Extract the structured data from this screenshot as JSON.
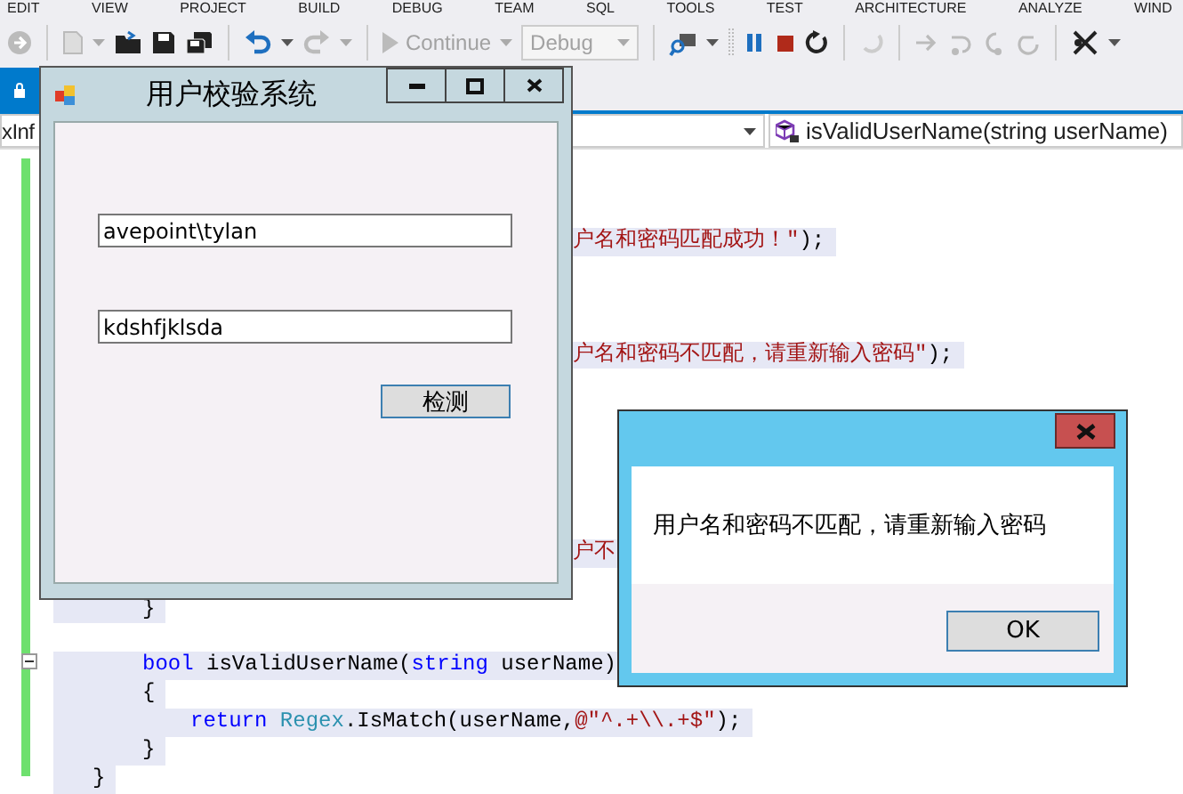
{
  "menu": [
    "EDIT",
    "VIEW",
    "PROJECT",
    "BUILD",
    "DEBUG",
    "TEAM",
    "SQL",
    "TOOLS",
    "TEST",
    "ARCHITECTURE",
    "ANALYZE",
    "WIND"
  ],
  "toolbar": {
    "continue_label": "Continue",
    "configuration": "Debug"
  },
  "navigation": {
    "left": "xInf",
    "right": "isValidUserName(string userName)"
  },
  "code_lines": [
    {
      "tokens": [
        {
          "text": "户名和密码匹配成功！\"",
          "kind": "string"
        },
        {
          "text": ");",
          "kind": "plain"
        }
      ]
    },
    {
      "tokens": [
        {
          "text": "户名和密码不匹配，请重新输入密码\"",
          "kind": "string"
        },
        {
          "text": ");",
          "kind": "plain"
        }
      ]
    },
    {
      "tokens": [
        {
          "text": "户不",
          "kind": "string"
        }
      ]
    },
    {
      "tokens": [
        {
          "text": "}",
          "kind": "plain"
        }
      ]
    },
    {
      "tokens": [
        {
          "text": "bool",
          "kind": "keyword"
        },
        {
          "text": " isValidUserName(",
          "kind": "plain"
        },
        {
          "text": "string",
          "kind": "keyword"
        },
        {
          "text": " userName)",
          "kind": "plain"
        }
      ]
    },
    {
      "tokens": [
        {
          "text": "{",
          "kind": "plain"
        }
      ]
    },
    {
      "tokens": [
        {
          "text": "return",
          "kind": "keyword"
        },
        {
          "text": " Regex",
          "kind": "type"
        },
        {
          "text": ".IsMatch(userName,",
          "kind": "plain"
        },
        {
          "text": "@\"^.+\\\\.+$\"",
          "kind": "string"
        },
        {
          "text": ");",
          "kind": "plain"
        }
      ]
    },
    {
      "tokens": [
        {
          "text": "}",
          "kind": "plain"
        }
      ]
    },
    {
      "tokens": [
        {
          "text": "}",
          "kind": "plain"
        }
      ]
    }
  ],
  "form_window": {
    "title": "用户校验系统",
    "fields": [
      {
        "value": "avepoint\\tylan"
      },
      {
        "value": "kdshfjklsda"
      }
    ],
    "button": "检测"
  },
  "message_box": {
    "message": "用户名和密码不匹配，请重新输入密码",
    "button": "OK"
  }
}
